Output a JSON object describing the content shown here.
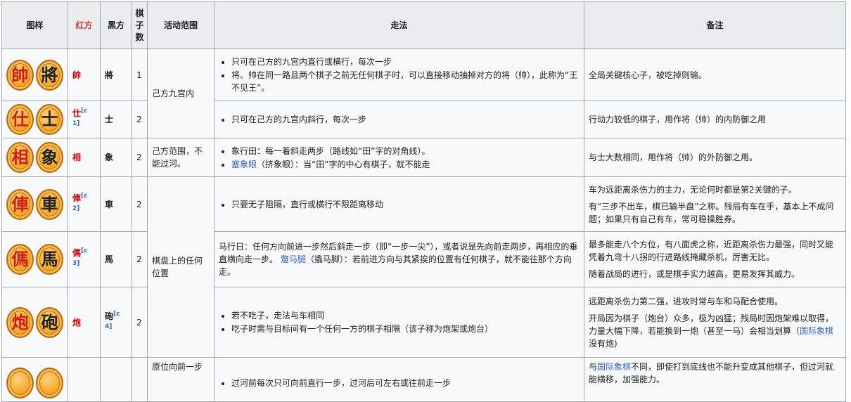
{
  "headers": {
    "pattern": "图样",
    "red": "红方",
    "black": "黑方",
    "count": "棋子数",
    "range": "活动范围",
    "move": "走法",
    "note": "备注"
  },
  "ranges": {
    "palace": "己方九宫内",
    "own_side": "己方范围，不能过河。",
    "anywhere": "棋盘上的任何位置",
    "pawn": "原位向前一步"
  },
  "rows": [
    {
      "red_glyph": "帥",
      "black_glyph": "將",
      "red": "帥",
      "red_sup": "",
      "black": "將",
      "black_sup": "",
      "count": "1",
      "moves": [
        "只可在己方的九宫内直行或横行，每次一步",
        "将、帅在同一路且两个棋子之前无任何棋子时，可以直接移动抽掉对方的将（帅），此称为“王不见王”。"
      ],
      "notes": [
        "全局关键核心子，被吃掉则输。"
      ]
    },
    {
      "red_glyph": "仕",
      "black_glyph": "士",
      "red": "仕",
      "red_sup": "[c 1]",
      "black": "士",
      "black_sup": "",
      "count": "2",
      "moves": [
        "只可在己方的九宫内斜行，每次一步"
      ],
      "notes": [
        "行动力较低的棋子，用作将（帅）的内防御之用"
      ]
    },
    {
      "red_glyph": "相",
      "black_glyph": "象",
      "red": "相",
      "red_sup": "",
      "black": "象",
      "black_sup": "",
      "count": "2",
      "move1": "象行田：每一着斜走两步（路线如“田”字的对角线）。",
      "move2_link": "塞象眼",
      "move2_rest": "（挤象眼）：当“田”字的中心有棋子，就不能走",
      "notes": [
        "与士大数相同，用作将（帅）的外防御之用。"
      ]
    },
    {
      "red_glyph": "俥",
      "black_glyph": "車",
      "red": "俥",
      "red_sup": "[c 2]",
      "black": "車",
      "black_sup": "",
      "count": "2",
      "moves": [
        "只要无子阻隔，直行或横行不限距离移动"
      ],
      "notes": [
        "车为远距离杀伤力的主力，无论何时都是第2关键的子。",
        "有“三步不出车，棋已输半盘”之称。残局有车在手，基本上不成问题；如果只有自己有车，常可稳操胜券。"
      ]
    },
    {
      "red_glyph": "傌",
      "black_glyph": "馬",
      "red": "傌",
      "red_sup": "[c 3]",
      "black": "馬",
      "black_sup": "",
      "count": "2",
      "move_a": "马行日：任何方向前进一步然后斜走一步（即“一步一尖”），或者说是先向前走两步，再相应的垂直横向走一步。",
      "move_link": "蹩马腿",
      "move_b": "（撬马脚）：若前进方向与其紧挨的位置有任何棋子，就不能往那个方向走。",
      "notes": [
        "最多能走八个方位，有八面虎之称，近距离杀伤力最强，同时又能凭着九弯十八拐的行进路线掩藏杀机，厉害无比。",
        "随着战局的进行，或是棋手实力越高，更易发挥其威力。"
      ]
    },
    {
      "red_glyph": "炮",
      "black_glyph": "砲",
      "red": "炮",
      "red_sup": "",
      "black": "砲",
      "black_sup": "[c 4]",
      "count": "2",
      "moves": [
        "若不吃子，走法与车相同",
        "吃子时需与目标间有一个任何一方的棋子相隔（该子称为炮架或炮台）"
      ],
      "note1": "远距离杀伤力第二强，进攻时常与车和马配合使用。",
      "note2_a": "开局因为棋子（炮台）众多，极为凶猛；残局时因炮架难以取得，力量大幅下降，若能换到一炮（甚至一马）会相当划算（",
      "note2_link": "国际象棋",
      "note2_b": "没有炮)"
    },
    {
      "move_partial": "过河前每次只可向前直行一步，过河后可左右或往前走一步",
      "note_a": "与",
      "note_link": "国际象棋",
      "note_b": "不同，即使打到底线也不能升变成其他棋子，但过河就能横移，加强能力。"
    }
  ]
}
